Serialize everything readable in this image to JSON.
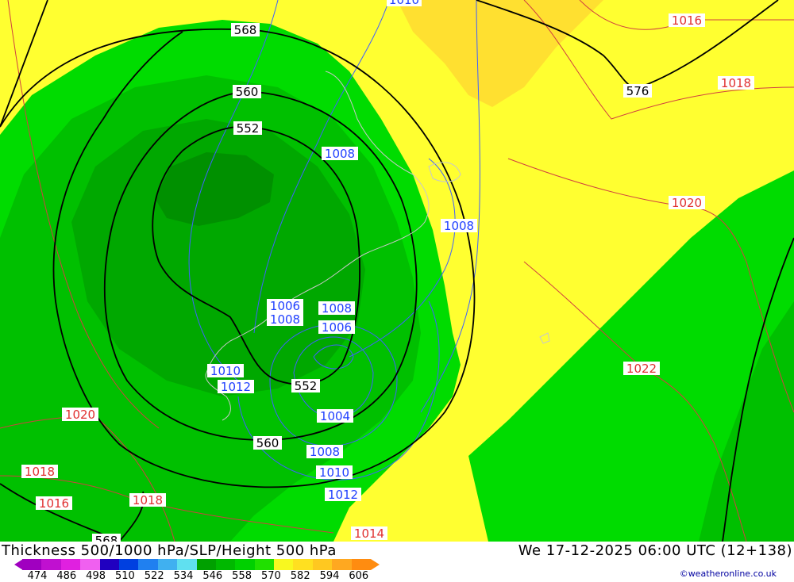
{
  "map": {
    "colors": {
      "yellow": "#ffff30",
      "gold": "#ffe030",
      "green_light": "#00dc00",
      "green_mid": "#00c000",
      "green_dark": "#00a800",
      "green_darker": "#009000",
      "height_line": "#000000",
      "slp_blue": "#4060ff",
      "slp_red": "#d04040"
    },
    "height_labels": [
      "568",
      "560",
      "552",
      "576",
      "552",
      "560",
      "568"
    ],
    "slp_blue_labels": [
      "1010",
      "1008",
      "1008",
      "1006",
      "1008",
      "1008",
      "1006",
      "1010",
      "1012",
      "1004",
      "1008",
      "1010",
      "1012"
    ],
    "slp_red_labels": [
      "1016",
      "1018",
      "1020",
      "1022",
      "1020",
      "1018",
      "1016",
      "1018",
      "1014"
    ]
  },
  "footer": {
    "title_left": "Thickness 500/1000 hPa/SLP/Height 500 hPa",
    "title_right": "We 17-12-2025 06:00 UTC (12+138)",
    "credit": "©weatheronline.co.uk",
    "legend_ticks": [
      "474",
      "486",
      "498",
      "510",
      "522",
      "534",
      "546",
      "558",
      "570",
      "582",
      "594",
      "606"
    ],
    "legend_colors": [
      "#a000c0",
      "#c010d0",
      "#e020e0",
      "#f060f0",
      "#2000c0",
      "#0040e0",
      "#2080f0",
      "#40b0f0",
      "#60e0f0",
      "#00a000",
      "#00b800",
      "#00d000",
      "#20e000",
      "#f8f820",
      "#ffe020",
      "#ffc820",
      "#ffa820",
      "#ff8c10"
    ]
  }
}
